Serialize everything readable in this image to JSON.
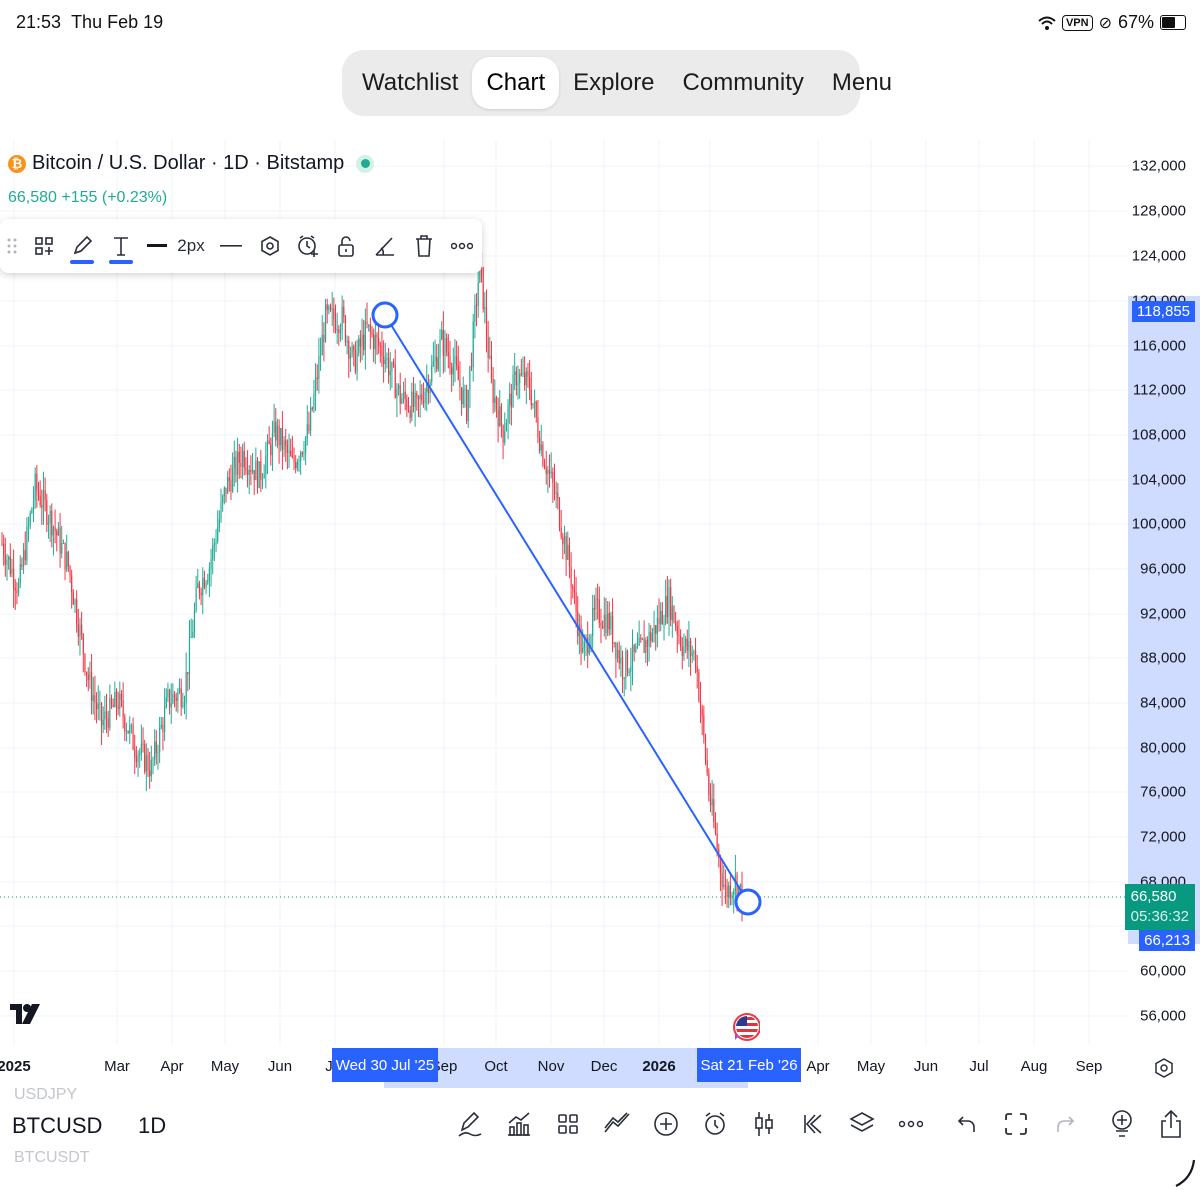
{
  "status_bar": {
    "time": "21:53",
    "date": "Thu Feb 19",
    "vpn": "VPN",
    "battery": "67%",
    "battery_level": 0.67
  },
  "nav": {
    "tabs": [
      {
        "label": "Watchlist",
        "active": false
      },
      {
        "label": "Chart",
        "active": true
      },
      {
        "label": "Explore",
        "active": false
      },
      {
        "label": "Community",
        "active": false
      },
      {
        "label": "Menu",
        "active": false
      }
    ]
  },
  "symbol": {
    "coin_icon": "bitcoin-icon",
    "title": "Bitcoin / U.S. Dollar · 1D · Bitstamp",
    "price_line": "66,580  +155 (+0.23%)"
  },
  "draw_toolbar": {
    "icons": [
      "drag-handle-icon",
      "objects-icon",
      "pencil-icon",
      "text-icon",
      "line-style-icon",
      "line-style-icon",
      "drawing-object-icon",
      "alert-icon",
      "lock-icon",
      "angle-icon",
      "trash-icon",
      "more-icon"
    ],
    "width_label": "2px"
  },
  "price_axis": {
    "ticks": [
      "132,000",
      "128,000",
      "124,000",
      "120,000",
      "116,000",
      "112,000",
      "108,000",
      "104,000",
      "100,000",
      "96,000",
      "92,000",
      "88,000",
      "84,000",
      "80,000",
      "76,000",
      "72,000",
      "68,000",
      "60,000",
      "56,000"
    ],
    "tag_top": "118,855",
    "tag_last_price": "66,580",
    "tag_countdown": "05:36:32",
    "tag_bottom": "66,213",
    "colors": {
      "blue": "#2962ff",
      "green": "#089981",
      "up": "#22ab94",
      "down": "#f23645"
    }
  },
  "time_axis": {
    "ticks": [
      "2025",
      "Mar",
      "Apr",
      "May",
      "Jun",
      "J",
      "Sep",
      "Oct",
      "Nov",
      "Dec",
      "2026",
      "Apr",
      "May",
      "Jun",
      "Jul",
      "Aug",
      "Sep"
    ],
    "start_tag": "Wed 30 Jul '25",
    "end_tag": "Sat 21 Feb '26"
  },
  "drawn_line": {
    "start": {
      "date": "Wed 30 Jul '25",
      "price": "118,855"
    },
    "end": {
      "date": "Sat 21 Feb '26",
      "price": "66,213"
    }
  },
  "logo": "tradingview-logo",
  "event_icon": "us-flag-event-icon",
  "bottom": {
    "symbol_prev": "USDJPY",
    "symbol": "BTCUSD",
    "symbol_next": "BTCUSDT",
    "interval": "1D",
    "tools": [
      "draw-icon",
      "indicators-icon",
      "layouts-icon",
      "strategy-icon",
      "add-icon",
      "alert-clock-icon",
      "candles-icon",
      "replay-icon",
      "layers-icon",
      "more-icon",
      "undo-icon",
      "fullscreen-icon",
      "redo-icon",
      "add-alert-icon",
      "share-icon"
    ]
  }
}
